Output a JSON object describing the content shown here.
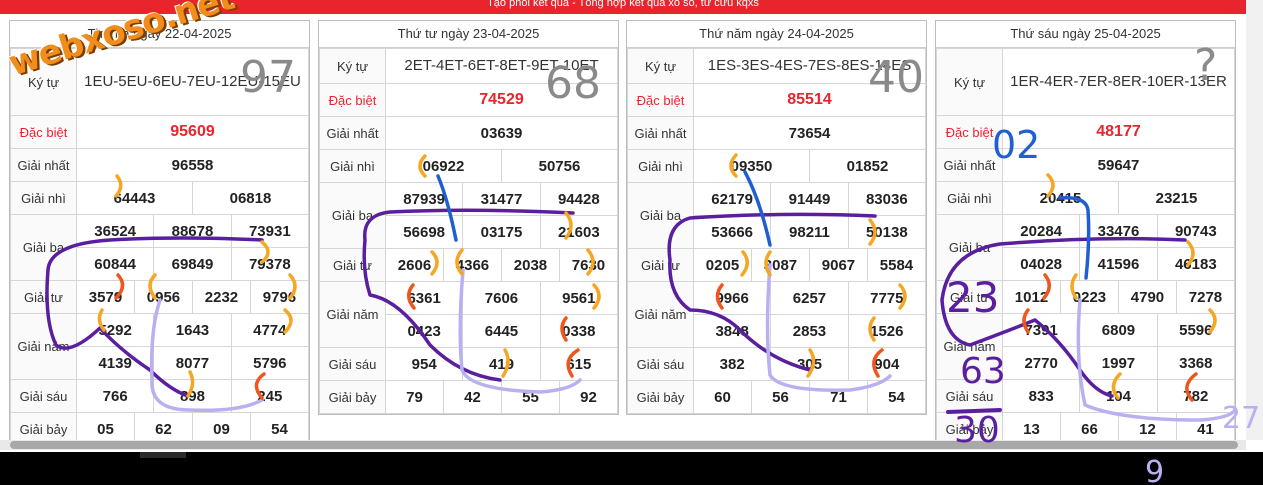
{
  "banner": "Tạo phôi kết quả - Tổng hợp kết quả xổ số, tử cửu kqxs",
  "logo_text": "webxoso.net",
  "labels": {
    "ky_tu": "Ký tự",
    "dac_biet": "Đặc biệt",
    "g1": "Giải nhất",
    "g2": "Giải nhì",
    "g3": "Giải ba",
    "g4": "Giải tư",
    "g5": "Giải năm",
    "g6": "Giải sáu",
    "g7": "Giải bảy"
  },
  "panels": [
    {
      "date": "Thứ ba ngày 22-04-2025",
      "ky_tu": "1EU-5EU-6EU-7EU-12EU-15EU",
      "db": "95609",
      "g1": "96558",
      "g2": [
        "64443",
        "06818"
      ],
      "g3": [
        "36524",
        "88678",
        "73931",
        "60844",
        "69849",
        "79378"
      ],
      "g4": [
        "3579",
        "0956",
        "2232",
        "9796"
      ],
      "g5": [
        "5292",
        "1643",
        "4774",
        "4139",
        "8077",
        "5796"
      ],
      "g6": [
        "766",
        "898",
        "245"
      ],
      "g7": [
        "05",
        "62",
        "09",
        "54"
      ]
    },
    {
      "date": "Thứ tư ngày 23-04-2025",
      "ky_tu": "2ET-4ET-6ET-8ET-9ET-10ET",
      "db": "74529",
      "g1": "03639",
      "g2": [
        "06922",
        "50756"
      ],
      "g3": [
        "87939",
        "31477",
        "94428",
        "56698",
        "03175",
        "21603"
      ],
      "g4": [
        "2606",
        "4366",
        "2038",
        "7630"
      ],
      "g5": [
        "6361",
        "7606",
        "9561",
        "0423",
        "6445",
        "0338"
      ],
      "g6": [
        "954",
        "419",
        "615"
      ],
      "g7": [
        "79",
        "42",
        "55",
        "92"
      ]
    },
    {
      "date": "Thứ năm ngày 24-04-2025",
      "ky_tu": "1ES-3ES-4ES-7ES-8ES-14ES",
      "db": "85514",
      "g1": "73654",
      "g2": [
        "09350",
        "01852"
      ],
      "g3": [
        "62179",
        "91449",
        "83036",
        "53666",
        "98211",
        "50138"
      ],
      "g4": [
        "0205",
        "3087",
        "9067",
        "5584"
      ],
      "g5": [
        "9966",
        "6257",
        "7775",
        "3848",
        "2853",
        "1526"
      ],
      "g6": [
        "382",
        "305",
        "904"
      ],
      "g7": [
        "60",
        "56",
        "71",
        "54"
      ]
    },
    {
      "date": "Thứ sáu ngày 25-04-2025",
      "ky_tu": "1ER-4ER-7ER-8ER-10ER-13ER",
      "db": "48177",
      "g1": "59647",
      "g2": [
        "20415",
        "23215"
      ],
      "g3": [
        "20284",
        "33476",
        "90743",
        "04028",
        "41596",
        "46183"
      ],
      "g4": [
        "1012",
        "0223",
        "4790",
        "7278"
      ],
      "g5": [
        "7391",
        "6809",
        "5596",
        "2770",
        "1997",
        "3368"
      ],
      "g6": [
        "833",
        "104",
        "782"
      ],
      "g7": [
        "13",
        "66",
        "12",
        "41"
      ]
    }
  ],
  "annotations": {
    "a97": "97",
    "a68": "68",
    "a40": "40",
    "aq": "?",
    "a02": "02",
    "a23": "23",
    "a63": "63",
    "a30": "30",
    "a27": "27",
    "a9": "9"
  },
  "colors": {
    "header_red": "#e8252c",
    "purple": "#5a1f9e",
    "orange": "#f5a623",
    "red_orange": "#f0551e",
    "blue": "#1f5fd1",
    "lavender": "#b8b0f0",
    "gray_ink": "#8a8a8a"
  }
}
